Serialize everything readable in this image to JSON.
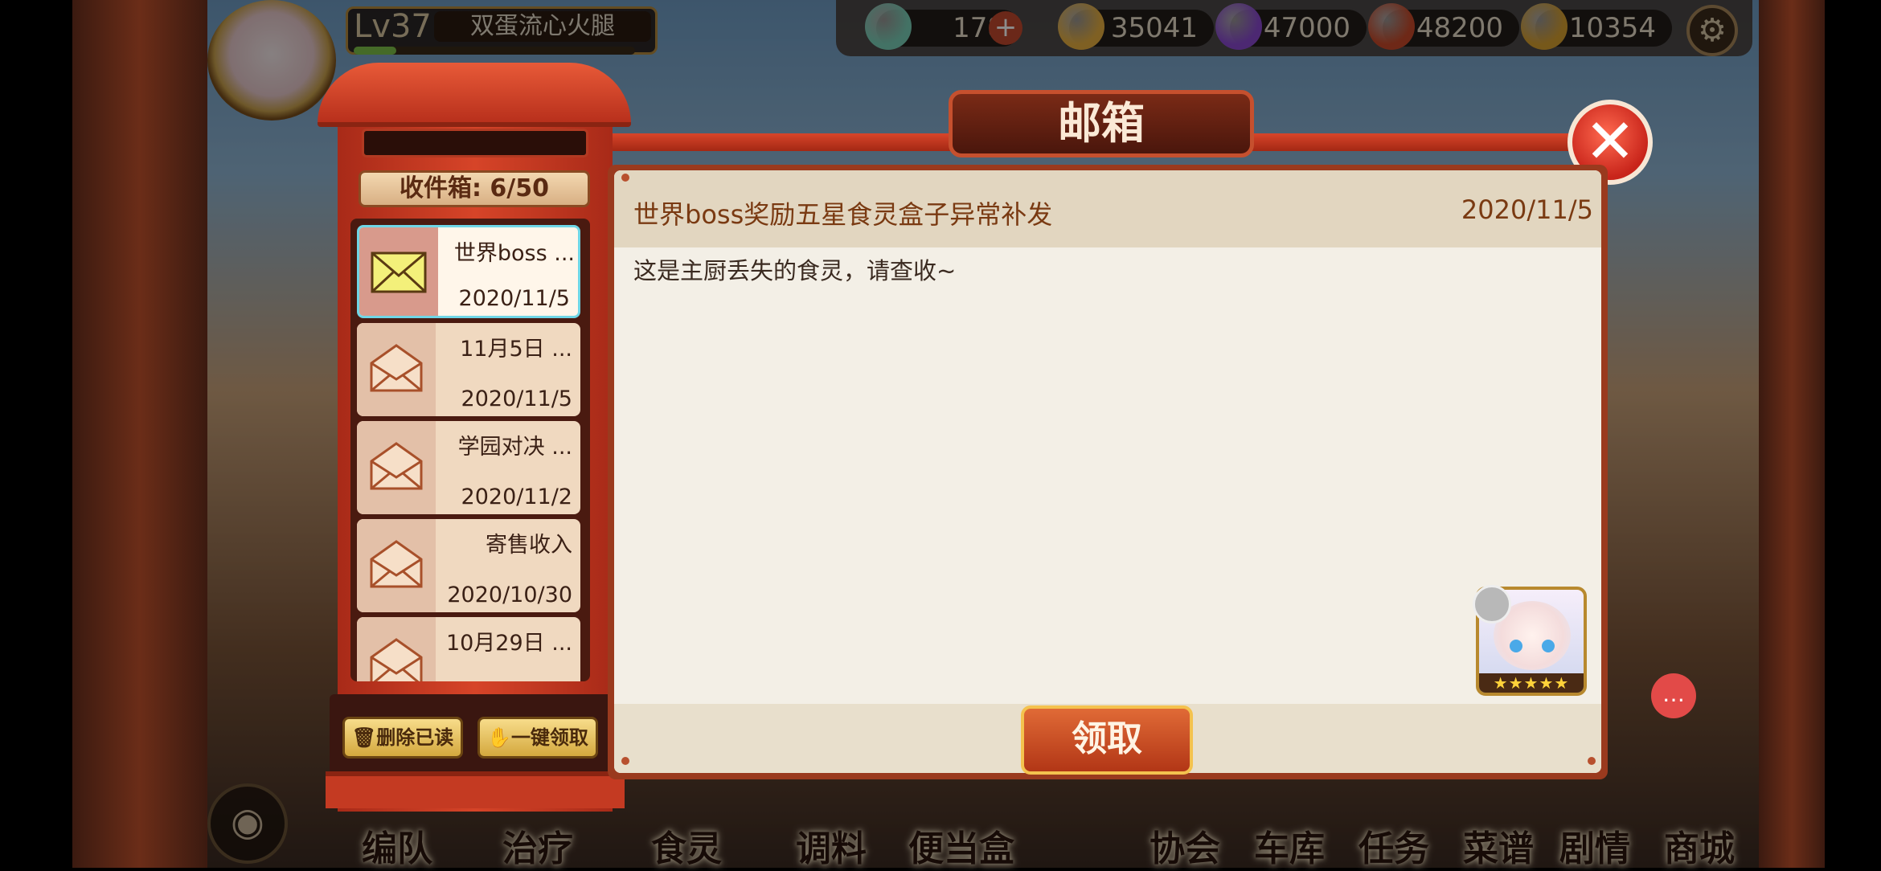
{
  "player": {
    "level_label": "Lv37",
    "name": "双蛋流心火腿",
    "xp_fraction": 0.15
  },
  "resources": [
    {
      "name": "crystal",
      "value": "178",
      "color": "#7ad0b8"
    },
    {
      "name": "gold",
      "value": "35041",
      "color": "#e8b040"
    },
    {
      "name": "eggplant",
      "value": "47000",
      "color": "#8a4ad0"
    },
    {
      "name": "food",
      "value": "48200",
      "color": "#c84a2a"
    },
    {
      "name": "bento",
      "value": "10354",
      "color": "#d8a030"
    }
  ],
  "mailbox": {
    "title": "邮箱",
    "inbox_count": "收件箱: 6/50",
    "items": [
      {
        "title": "世界boss ...",
        "date": "2020/11/5",
        "selected": true
      },
      {
        "title": "11月5日 ...",
        "date": "2020/11/5",
        "selected": false
      },
      {
        "title": "学园对决 ...",
        "date": "2020/11/2",
        "selected": false
      },
      {
        "title": "寄售收入",
        "date": "2020/10/30",
        "selected": false
      },
      {
        "title": "10月29日 ...",
        "date": "",
        "selected": false
      }
    ],
    "delete_read_label": "删除已读",
    "claim_all_label": "一键领取"
  },
  "message": {
    "subject": "世界boss奖励五星食灵盒子异常补发",
    "date": "2020/11/5",
    "body": "这是主厨丢失的食灵，请查收~",
    "reward_stars": "★★★★★",
    "claim_label": "领取"
  },
  "bottom_nav": {
    "left": [
      "编队",
      "治疗",
      "食灵",
      "调料",
      "便当盒"
    ],
    "right": [
      "协会",
      "车库",
      "任务",
      "菜谱",
      "剧情",
      "商城"
    ]
  }
}
